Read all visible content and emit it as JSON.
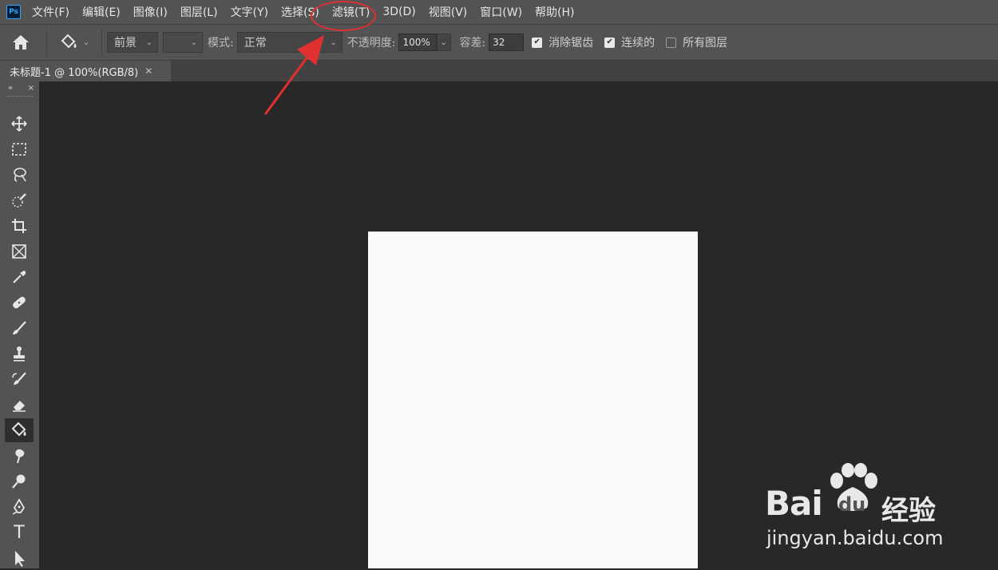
{
  "app": {
    "logo_text": "Ps"
  },
  "menu": {
    "items": [
      "文件(F)",
      "编辑(E)",
      "图像(I)",
      "图层(L)",
      "文字(Y)",
      "选择(S)",
      "滤镜(T)",
      "3D(D)",
      "视图(V)",
      "窗口(W)",
      "帮助(H)"
    ]
  },
  "options": {
    "fill_source": "前景",
    "mode_label": "模式:",
    "mode_value": "正常",
    "opacity_label": "不透明度:",
    "opacity_value": "100%",
    "tolerance_label": "容差:",
    "tolerance_value": "32",
    "checkboxes": [
      {
        "label": "消除锯齿",
        "checked": true
      },
      {
        "label": "连续的",
        "checked": true
      },
      {
        "label": "所有图层",
        "checked": false
      }
    ]
  },
  "document": {
    "tab_title": "未标题-1 @ 100%(RGB/8)"
  },
  "toolbar": {
    "collapse_glyph": "»",
    "close_glyph": "×",
    "tools": [
      "move-tool",
      "marquee-tool",
      "lasso-tool",
      "quick-selection-tool",
      "crop-tool",
      "frame-tool",
      "eyedropper-tool",
      "healing-brush-tool",
      "brush-tool",
      "clone-stamp-tool",
      "history-brush-tool",
      "eraser-tool",
      "paint-bucket-tool",
      "smudge-tool",
      "dodge-tool",
      "pen-tool",
      "type-tool",
      "path-selection-tool"
    ],
    "active": "paint-bucket-tool",
    "type_glyph": "T"
  },
  "annotation": {
    "color": "#e03030",
    "highlighted_menu": "滤镜(T)"
  },
  "watermark": {
    "brand": "Bai",
    "brand_du": "du",
    "brand_jy": "经验",
    "url": "jingyan.baidu.com"
  },
  "colors": {
    "menubar": "#535353",
    "workspace": "#282828",
    "canvas": "#fafafa",
    "ps_blue": "#31a8ff"
  }
}
